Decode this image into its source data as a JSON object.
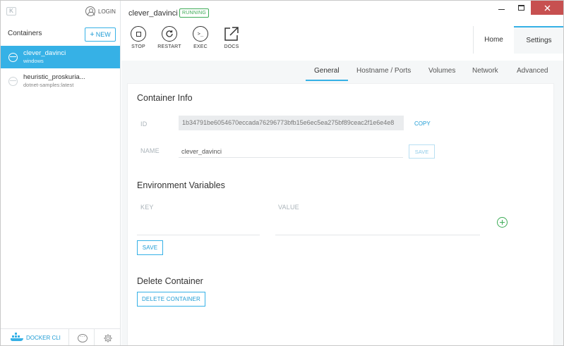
{
  "sidebar": {
    "login_label": "LOGIN",
    "containers_heading": "Containers",
    "new_button": "NEW",
    "containers": [
      {
        "name": "clever_davinci",
        "image": "windows",
        "active": true
      },
      {
        "name": "heuristic_proskuria...",
        "image": "dotnet-samples:latest",
        "active": false
      }
    ],
    "docker_cli_label": "DOCKER CLI"
  },
  "header": {
    "container_name": "clever_davinci",
    "status": "RUNNING",
    "actions": [
      {
        "label": "STOP",
        "icon": "stop-icon"
      },
      {
        "label": "RESTART",
        "icon": "restart-icon"
      },
      {
        "label": "EXEC",
        "icon": "terminal-icon"
      },
      {
        "label": "DOCS",
        "icon": "external-link-icon"
      }
    ],
    "tabs": {
      "home": "Home",
      "settings": "Settings"
    }
  },
  "settings_tabs": [
    "General",
    "Hostname / Ports",
    "Volumes",
    "Network",
    "Advanced"
  ],
  "general": {
    "container_info_title": "Container Info",
    "id_label": "ID",
    "id_value": "1b34791be6054670eccada76296773bfb15e6ec5ea275bf89ceac2f1e6e4e8",
    "copy_label": "COPY",
    "name_label": "NAME",
    "name_value": "clever_davinci",
    "save_label": "SAVE",
    "env_title": "Environment Variables",
    "key_label": "KEY",
    "value_label": "VALUE",
    "env_save_label": "SAVE",
    "delete_title": "Delete Container",
    "delete_button": "DELETE CONTAINER"
  },
  "colors": {
    "accent": "#36b1e6",
    "running": "#3dab56",
    "close": "#c75050"
  }
}
